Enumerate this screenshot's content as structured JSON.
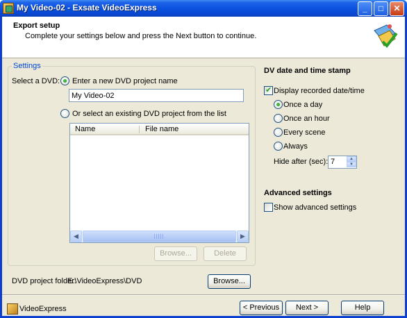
{
  "window": {
    "title": "My Video-02 - Exsate VideoExpress",
    "min_glyph": "_",
    "max_glyph": "□",
    "close_glyph": "✕"
  },
  "header": {
    "title": "Export setup",
    "subtitle": "Complete your settings below and press the Next button to continue."
  },
  "settings": {
    "group_label": "Settings",
    "select_dvd_label": "Select a DVD:",
    "new_project_label": "Enter a new DVD project name",
    "new_project_value": "My Video-02",
    "existing_project_label": "Or select an existing DVD project from the list",
    "columns": [
      "Name",
      "File name"
    ],
    "browse_label": "Browse...",
    "delete_label": "Delete"
  },
  "folder": {
    "label": "DVD project folder:",
    "path": "E:\\VideoExpress\\DVD",
    "browse_label": "Browse..."
  },
  "datestamp": {
    "title": "DV date and time stamp",
    "display_label": "Display recorded date/time",
    "options": [
      "Once a day",
      "Once an hour",
      "Every scene",
      "Always"
    ],
    "selected_option": "Once a day",
    "hide_after_label": "Hide after (sec):",
    "hide_after_value": "7"
  },
  "advanced": {
    "title": "Advanced settings",
    "show_label": "Show advanced settings"
  },
  "footer": {
    "brand": "VideoExpress",
    "previous_label": "< Previous",
    "next_label": "Next >",
    "help_label": "Help"
  },
  "colors": {
    "title_bar": "#0a52e0",
    "dialog_bg": "#ece9d8",
    "group_label": "#0046d5"
  },
  "icons": [
    "app-icon",
    "wizard-icon",
    "minimize-icon",
    "maximize-icon",
    "close-icon",
    "scroll-left-icon",
    "scroll-right-icon",
    "spin-up-icon",
    "spin-down-icon"
  ]
}
